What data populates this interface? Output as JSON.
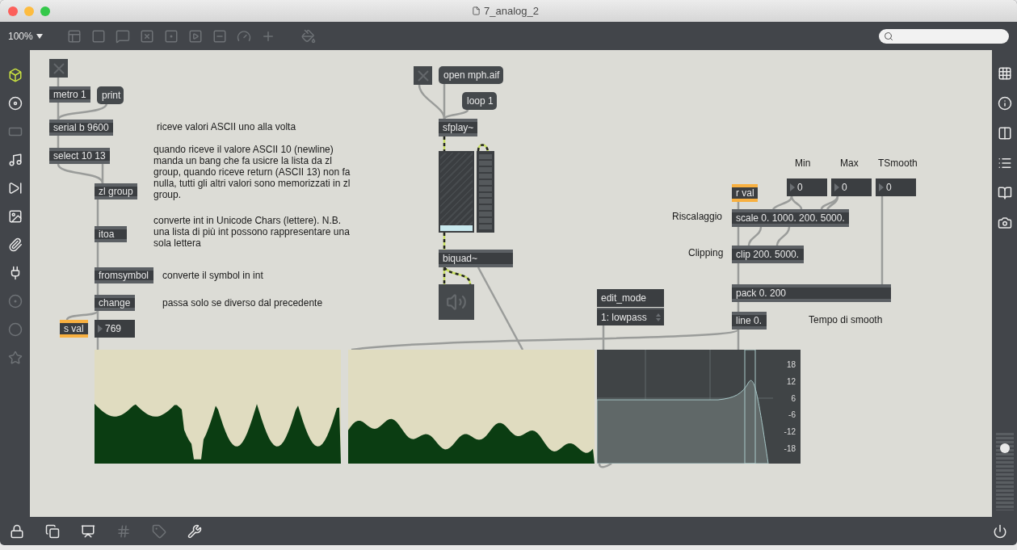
{
  "window": {
    "title": "7_analog_2"
  },
  "toolbar": {
    "zoom": "100%"
  },
  "patch": {
    "objects": [
      {
        "kind": "toggle",
        "on": false
      },
      {
        "kind": "object",
        "text": "metro 1"
      },
      {
        "kind": "message",
        "text": "print"
      },
      {
        "kind": "object",
        "text": "serial b 9600"
      },
      {
        "kind": "comment",
        "text": "riceve valori ASCII uno alla volta"
      },
      {
        "kind": "object",
        "text": "select 10 13"
      },
      {
        "kind": "object",
        "text": "zl group"
      },
      {
        "kind": "comment",
        "text": "quando riceve il valore ASCII 10 (newline) manda un bang che fa usicre la lista da zl group, quando riceve return (ASCII 13) non fa nulla, tutti gli altri valori sono memorizzati in zl group."
      },
      {
        "kind": "object",
        "text": "itoa"
      },
      {
        "kind": "comment",
        "text": "converte int in Unicode Chars (lettere). N.B. una lista di più int possono rappresentare una sola lettera"
      },
      {
        "kind": "object",
        "text": "fromsymbol"
      },
      {
        "kind": "comment",
        "text": "converte il symbol in int"
      },
      {
        "kind": "object",
        "text": "change"
      },
      {
        "kind": "comment",
        "text": "passa solo se diverso dal precedente"
      },
      {
        "kind": "send",
        "text": "s val"
      },
      {
        "kind": "number",
        "value": "769"
      },
      {
        "kind": "toggle",
        "on": false
      },
      {
        "kind": "message",
        "text": "open mph.aif"
      },
      {
        "kind": "message",
        "text": "loop 1"
      },
      {
        "kind": "object",
        "text": "sfplay~"
      },
      {
        "kind": "gain",
        "level": 0
      },
      {
        "kind": "meter"
      },
      {
        "kind": "object",
        "text": "biquad~"
      },
      {
        "kind": "speaker"
      },
      {
        "kind": "label",
        "text": "edit_mode"
      },
      {
        "kind": "menu",
        "value": "1: lowpass"
      },
      {
        "kind": "comment",
        "text": "Min"
      },
      {
        "kind": "comment",
        "text": "Max"
      },
      {
        "kind": "comment",
        "text": "TSmooth"
      },
      {
        "kind": "number",
        "value": "0"
      },
      {
        "kind": "number",
        "value": "0"
      },
      {
        "kind": "number",
        "value": "0"
      },
      {
        "kind": "send",
        "text": "r val"
      },
      {
        "kind": "comment",
        "text": "Riscalaggio"
      },
      {
        "kind": "object",
        "text": "scale 0. 1000. 200. 5000."
      },
      {
        "kind": "comment",
        "text": "Clipping"
      },
      {
        "kind": "object",
        "text": "clip 200. 5000."
      },
      {
        "kind": "object",
        "text": "pack 0. 200"
      },
      {
        "kind": "object",
        "text": "line 0."
      },
      {
        "kind": "comment",
        "text": "Tempo di smooth"
      },
      {
        "kind": "waveform"
      },
      {
        "kind": "waveform"
      },
      {
        "kind": "filter-graph",
        "labels": [
          "18",
          "12",
          "6",
          "-6",
          "-12",
          "-18"
        ]
      }
    ]
  },
  "master_volume": {
    "level": 0.85
  }
}
